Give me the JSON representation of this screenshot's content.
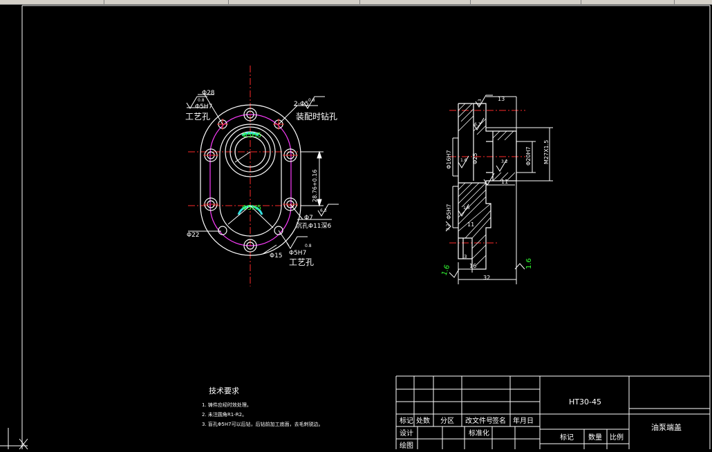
{
  "toolbar": {
    "visible": true
  },
  "front_view": {
    "dia_28": "Φ28",
    "roughness_top_left": "0.8",
    "tol_5h7_top": "Φ5H7",
    "process_hole_top": "工艺孔",
    "holes_2_5": "2-Φ5",
    "roughness_top_right": "0.8",
    "assembly_drill_note": "装配时钻孔",
    "center_dim_top": "Φ5H5",
    "center_dim_bottom": "Φ5H5",
    "vertical_dim": "28.76+0.16",
    "dia_7": "Φ7",
    "roughness_right": "6.3",
    "sink_hole_note": "沉孔Φ11深6",
    "dia_22": "Φ22",
    "dia_15": "Φ15",
    "tol_5h7_bottom": "Φ5H7",
    "roughness_bottom": "0.8",
    "process_hole_bottom": "工艺孔"
  },
  "section_view": {
    "dim_13": "13",
    "roughness_top": "6.3",
    "roughness_inner": "6.3",
    "dia_16h7": "Φ16H7",
    "dia_25": "Φ25",
    "dia_20h7": "Φ20H7",
    "thread_m27": "M27X1.5",
    "roughness_16": "1.6",
    "roughness_32": "3.2",
    "dim_11_top": "11",
    "dia_5h7": "Φ5H7",
    "roughness_16b": "1.6",
    "roughness_32b": "3.2",
    "dim_11_bottom": "11",
    "dim_3": "3",
    "dim_16": "16",
    "dim_32": "32",
    "roughness_left": "1.6",
    "roughness_right": "1.6"
  },
  "tech_requirements": {
    "title": "技术要求",
    "items": [
      "1. 铸件应经时效处理。",
      "2. 未注圆角R1-R2。",
      "3. 盲孔Φ5H7可以后钻，后钻前加工底面，去毛刺锐边。"
    ]
  },
  "title_block": {
    "material": "HT30-45",
    "part_name": "油泵端盖",
    "h_mark": "标记",
    "h_count": "处数",
    "h_zone": "分区",
    "h_docno": "改文件号",
    "h_sign": "签名",
    "h_date": "年月日",
    "design": "设计",
    "standardize": "标准化",
    "draw": "绘图",
    "stage_mark": "标记",
    "weight": "数量",
    "scale": "比例"
  },
  "colors": {
    "background": "#000000",
    "line": "#ffffff",
    "center_line": "#ff2a2a",
    "outline_magenta": "#ff3cff",
    "highlight_green": "#33ff33",
    "highlight_cyan": "#33e0e0",
    "toolbar": "#d4d0c8"
  }
}
